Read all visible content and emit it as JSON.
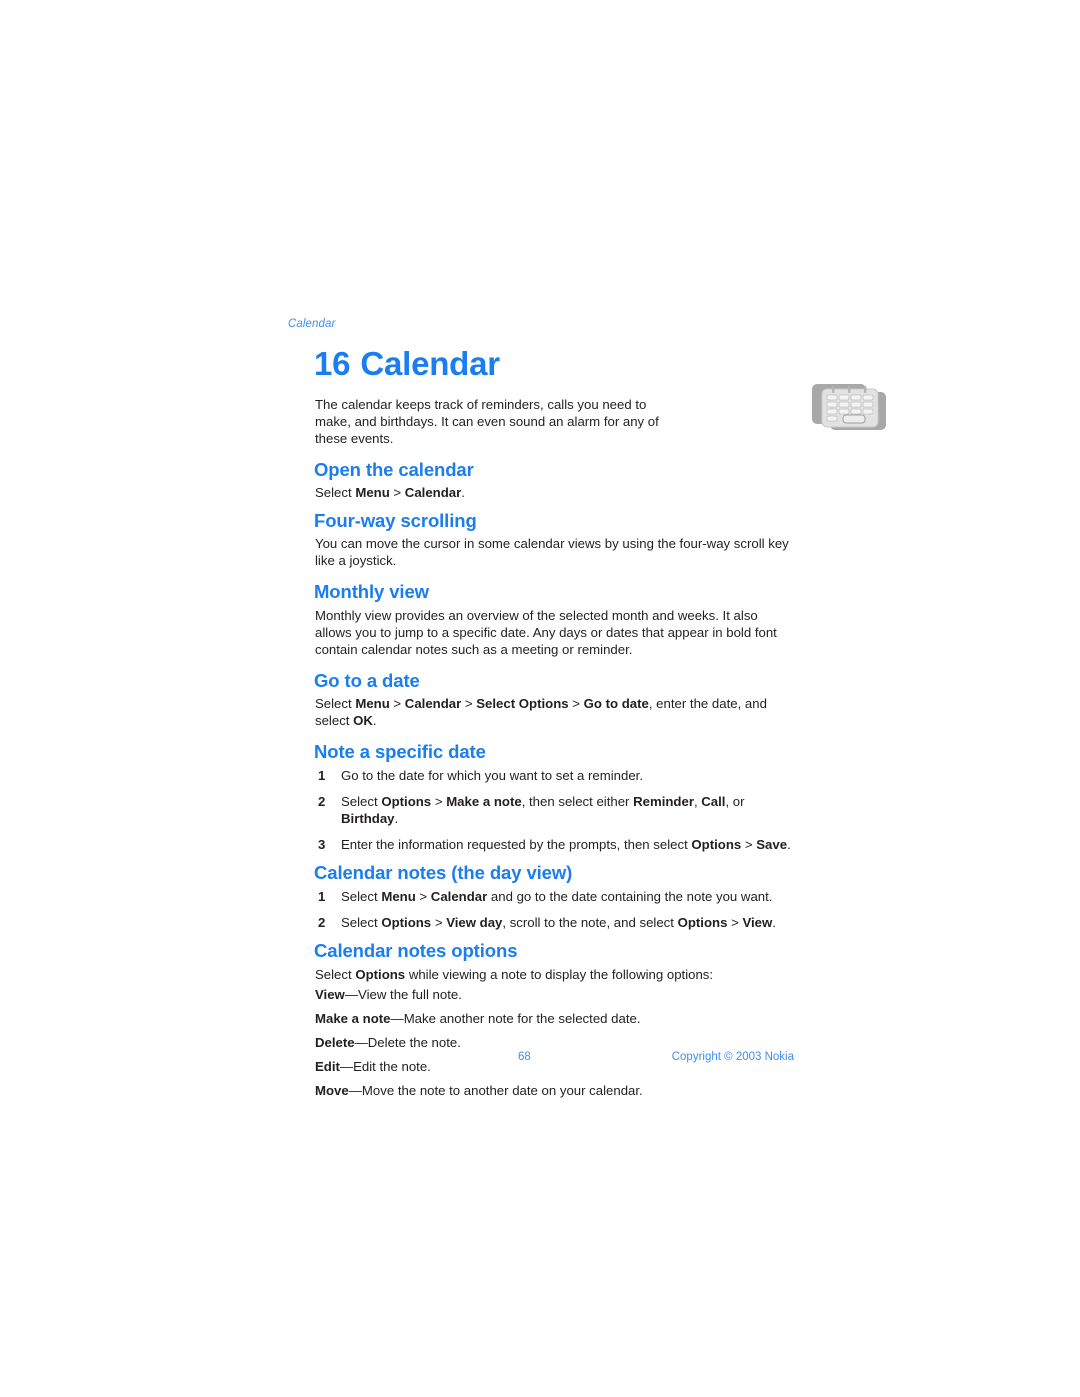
{
  "document": {
    "running_header": "Calendar",
    "page_number": "68",
    "copyright": "Copyright © 2003 Nokia",
    "accent_color": "#1a7df0",
    "footer_color": "#3d8ef5",
    "text_color": "#231f20",
    "background_color": "#ffffff"
  },
  "chapter": {
    "number": "16",
    "title": "Calendar",
    "icon": "calendar-icon",
    "intro": "The calendar keeps track of reminders, calls you need to make, and birthdays. It can even sound an alarm for any of these events."
  },
  "sections": {
    "open_the_calendar": {
      "heading": "Open the calendar",
      "line_prefix": "Select ",
      "line_menu": "Menu",
      "line_sep": " > ",
      "line_target": "Calendar",
      "line_end": "."
    },
    "four_way_scrolling": {
      "heading": "Four-way scrolling",
      "body": "You can move the cursor in some calendar views by using the four-way scroll key like a joystick."
    },
    "monthly_view": {
      "heading": "Monthly view",
      "body": "Monthly view provides an overview of the selected month and weeks. It also allows you to jump to a specific date. Any days or dates that appear in bold font contain calendar notes such as a meeting or reminder."
    },
    "go_to_a_date": {
      "heading": "Go to a date",
      "p1": "Select ",
      "b1": "Menu",
      "s1": " > ",
      "b2": "Calendar",
      "s2": " > ",
      "b3": "Select Options",
      "s3": " > ",
      "b4": "Go to date",
      "p2": ", enter the date, and select ",
      "b5": "OK",
      "p3": "."
    },
    "note_a_specific_date": {
      "heading": "Note a specific date",
      "steps": [
        {
          "num": "1",
          "parts": [
            {
              "t": "Go to the date for which you want to set a reminder.",
              "b": false
            }
          ]
        },
        {
          "num": "2",
          "parts": [
            {
              "t": "Select ",
              "b": false
            },
            {
              "t": "Options",
              "b": true
            },
            {
              "t": " > ",
              "b": false
            },
            {
              "t": "Make a note",
              "b": true
            },
            {
              "t": ", then select either ",
              "b": false
            },
            {
              "t": "Reminder",
              "b": true
            },
            {
              "t": ", ",
              "b": false
            },
            {
              "t": "Call",
              "b": true
            },
            {
              "t": ", or ",
              "b": false
            },
            {
              "t": "Birthday",
              "b": true
            },
            {
              "t": ".",
              "b": false
            }
          ]
        },
        {
          "num": "3",
          "parts": [
            {
              "t": "Enter the information requested by the prompts, then select ",
              "b": false
            },
            {
              "t": "Options",
              "b": true
            },
            {
              "t": " > ",
              "b": false
            },
            {
              "t": "Save",
              "b": true
            },
            {
              "t": ".",
              "b": false
            }
          ]
        }
      ]
    },
    "calendar_notes_day_view": {
      "heading": "Calendar notes (the day view)",
      "steps": [
        {
          "num": "1",
          "parts": [
            {
              "t": "Select ",
              "b": false
            },
            {
              "t": "Menu",
              "b": true
            },
            {
              "t": " > ",
              "b": false
            },
            {
              "t": "Calendar",
              "b": true
            },
            {
              "t": " and go to the date containing the note you want.",
              "b": false
            }
          ]
        },
        {
          "num": "2",
          "parts": [
            {
              "t": "Select ",
              "b": false
            },
            {
              "t": "Options",
              "b": true
            },
            {
              "t": " > ",
              "b": false
            },
            {
              "t": "View day",
              "b": true
            },
            {
              "t": ", scroll to the note, and select ",
              "b": false
            },
            {
              "t": "Options",
              "b": true
            },
            {
              "t": " > ",
              "b": false
            },
            {
              "t": "View",
              "b": true
            },
            {
              "t": ".",
              "b": false
            }
          ]
        }
      ]
    },
    "calendar_notes_options": {
      "heading": "Calendar notes options",
      "lead_p1": "Select ",
      "lead_b": "Options",
      "lead_p2": " while viewing a note to display the following options:",
      "options": [
        {
          "term": "View",
          "desc": "—View the full note."
        },
        {
          "term": "Make a note",
          "desc": "—Make another note for the selected date."
        },
        {
          "term": "Delete",
          "desc": "—Delete the note."
        },
        {
          "term": "Edit",
          "desc": "—Edit the note."
        },
        {
          "term": "Move",
          "desc": "—Move the note to another date on your calendar."
        }
      ]
    }
  }
}
